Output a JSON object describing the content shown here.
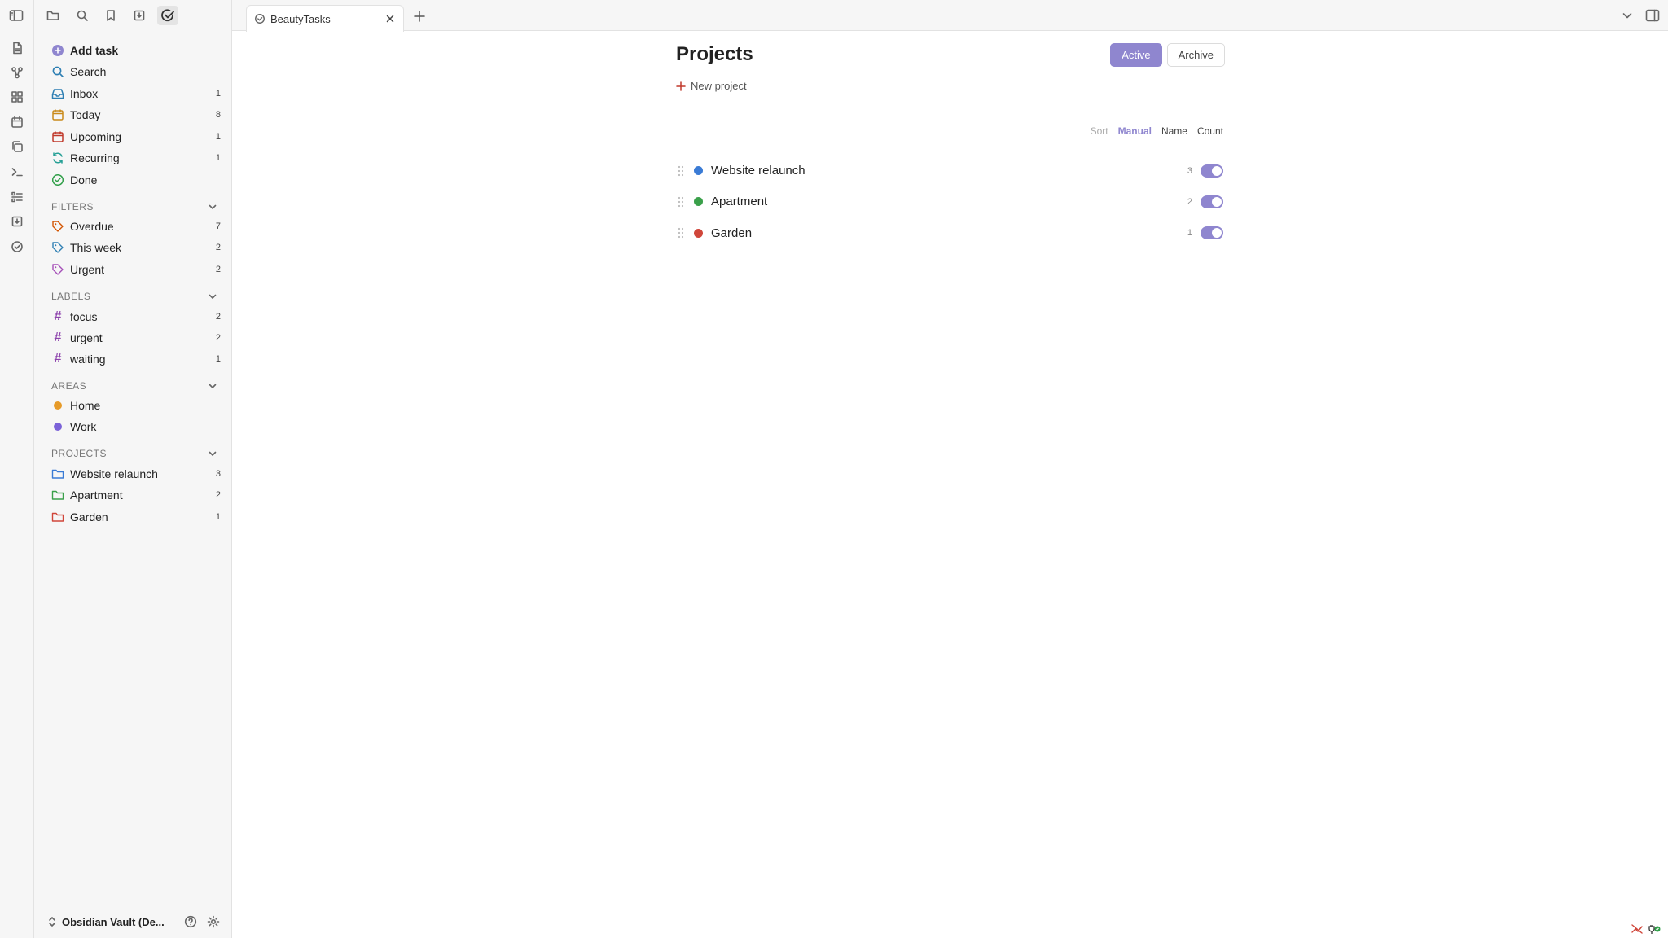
{
  "tab": {
    "title": "BeautyTasks"
  },
  "sidebar": {
    "actions": [
      {
        "label": "Add task"
      },
      {
        "label": "Search"
      }
    ],
    "views": [
      {
        "label": "Inbox",
        "count": "1",
        "color": "#2e7fb3"
      },
      {
        "label": "Today",
        "count": "8",
        "color": "#c98a1a"
      },
      {
        "label": "Upcoming",
        "count": "1",
        "color": "#c0392b"
      },
      {
        "label": "Recurring",
        "count": "1",
        "color": "#27a096"
      },
      {
        "label": "Done",
        "count": "",
        "color": "#2e9e47"
      }
    ],
    "filters": {
      "title": "FILTERS",
      "items": [
        {
          "label": "Overdue",
          "count": "7",
          "color": "#d35400"
        },
        {
          "label": "This week",
          "count": "2",
          "color": "#2e7fb3"
        },
        {
          "label": "Urgent",
          "count": "2",
          "color": "#a54fb8"
        }
      ]
    },
    "labels": {
      "title": "LABELS",
      "items": [
        {
          "label": "focus",
          "count": "2",
          "color": "#8e44ad"
        },
        {
          "label": "urgent",
          "count": "2",
          "color": "#8e44ad"
        },
        {
          "label": "waiting",
          "count": "1",
          "color": "#8e44ad"
        }
      ]
    },
    "areas": {
      "title": "AREAS",
      "items": [
        {
          "label": "Home",
          "color": "#e69a28"
        },
        {
          "label": "Work",
          "color": "#7b62d8"
        }
      ]
    },
    "projects": {
      "title": "PROJECTS",
      "items": [
        {
          "label": "Website relaunch",
          "count": "3",
          "color": "#3a7bd5"
        },
        {
          "label": "Apartment",
          "count": "2",
          "color": "#3aa04a"
        },
        {
          "label": "Garden",
          "count": "1",
          "color": "#d0463a"
        }
      ]
    },
    "vault": {
      "name": "Obsidian Vault (De..."
    }
  },
  "main": {
    "title": "Projects",
    "segments": {
      "active": "Active",
      "archive": "Archive"
    },
    "new_project": "New project",
    "sort": {
      "label": "Sort",
      "manual": "Manual",
      "name": "Name",
      "count": "Count"
    },
    "projects": [
      {
        "name": "Website relaunch",
        "count": "3",
        "color": "#3a7bd5",
        "enabled": true
      },
      {
        "name": "Apartment",
        "count": "2",
        "color": "#3aa04a",
        "enabled": true
      },
      {
        "name": "Garden",
        "count": "1",
        "color": "#d0463a",
        "enabled": true
      }
    ]
  }
}
